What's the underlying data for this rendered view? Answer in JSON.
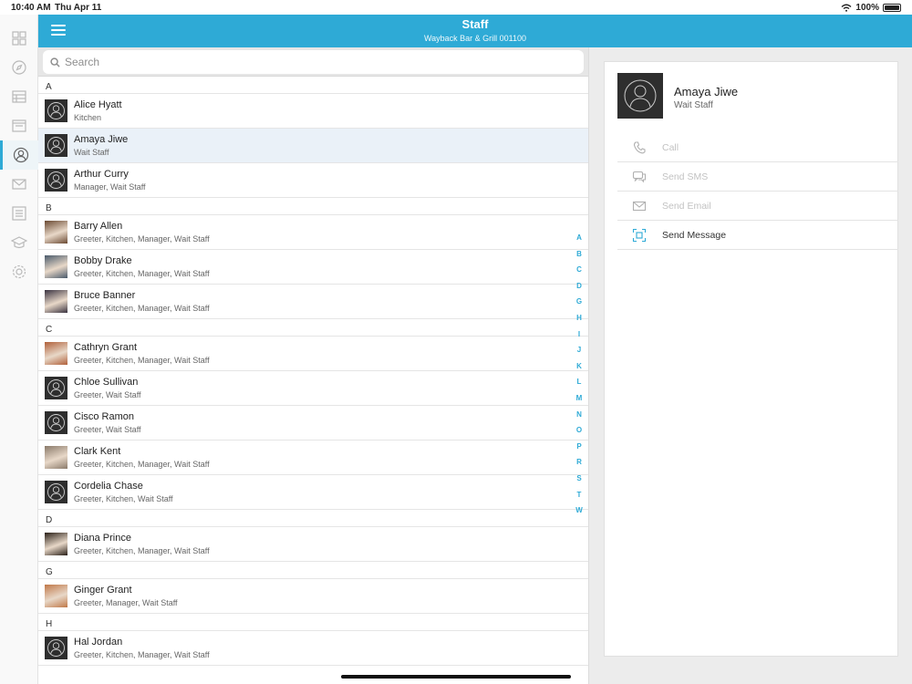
{
  "status": {
    "time": "10:40 AM",
    "date": "Thu Apr 11",
    "battery": "100%"
  },
  "rail": {
    "items": [
      {
        "icon": "dashboard-icon",
        "active": false
      },
      {
        "icon": "compass-icon",
        "active": false
      },
      {
        "icon": "table-icon",
        "active": false
      },
      {
        "icon": "calendar-icon",
        "active": false
      },
      {
        "icon": "staff-icon",
        "active": true
      },
      {
        "icon": "mail-icon",
        "active": false
      },
      {
        "icon": "checklist-icon",
        "active": false
      },
      {
        "icon": "training-icon",
        "active": false
      },
      {
        "icon": "settings-icon",
        "active": false
      }
    ]
  },
  "header": {
    "title": "Staff",
    "subtitle": "Wayback Bar & Grill 001100"
  },
  "search": {
    "placeholder": "Search"
  },
  "sections": [
    {
      "letter": "A",
      "people": [
        {
          "name": "Alice Hyatt",
          "roles": "Kitchen",
          "photo": null
        },
        {
          "name": "Amaya Jiwe",
          "roles": "Wait Staff",
          "photo": null,
          "selected": true
        },
        {
          "name": "Arthur Curry",
          "roles": "Manager, Wait Staff",
          "photo": null
        }
      ]
    },
    {
      "letter": "B",
      "people": [
        {
          "name": "Barry Allen",
          "roles": "Greeter, Kitchen, Manager, Wait Staff",
          "photo": "#6b4a33"
        },
        {
          "name": "Bobby Drake",
          "roles": "Greeter, Kitchen, Manager, Wait Staff",
          "photo": "#4a5a6b"
        },
        {
          "name": "Bruce Banner",
          "roles": "Greeter, Kitchen, Manager, Wait Staff",
          "photo": "#3a3340"
        }
      ]
    },
    {
      "letter": "C",
      "people": [
        {
          "name": "Cathryn Grant",
          "roles": "Greeter, Kitchen, Manager, Wait Staff",
          "photo": "#b0603a"
        },
        {
          "name": "Chloe Sullivan",
          "roles": "Greeter, Wait Staff",
          "photo": null
        },
        {
          "name": "Cisco Ramon",
          "roles": "Greeter, Wait Staff",
          "photo": null
        },
        {
          "name": "Clark Kent",
          "roles": "Greeter, Kitchen, Manager, Wait Staff",
          "photo": "#8a7a6a"
        },
        {
          "name": "Cordelia Chase",
          "roles": "Greeter, Kitchen, Wait Staff",
          "photo": null
        }
      ]
    },
    {
      "letter": "D",
      "people": [
        {
          "name": "Diana Prince",
          "roles": "Greeter, Kitchen, Manager, Wait Staff",
          "photo": "#2a2018"
        }
      ]
    },
    {
      "letter": "G",
      "people": [
        {
          "name": "Ginger Grant",
          "roles": "Greeter, Manager, Wait Staff",
          "photo": "#c07848"
        }
      ]
    },
    {
      "letter": "H",
      "people": [
        {
          "name": "Hal Jordan",
          "roles": "Greeter, Kitchen, Manager, Wait Staff",
          "photo": null
        }
      ]
    }
  ],
  "index_letters": [
    "A",
    "B",
    "C",
    "D",
    "G",
    "H",
    "I",
    "J",
    "K",
    "L",
    "M",
    "N",
    "O",
    "P",
    "R",
    "S",
    "T",
    "W"
  ],
  "detail": {
    "name": "Amaya Jiwe",
    "role": "Wait Staff",
    "actions": [
      {
        "label": "Call",
        "icon": "phone-icon",
        "enabled": false
      },
      {
        "label": "Send SMS",
        "icon": "chat-icon",
        "enabled": false
      },
      {
        "label": "Send Email",
        "icon": "mail-icon",
        "enabled": false
      },
      {
        "label": "Send Message",
        "icon": "message-icon",
        "enabled": true
      }
    ]
  },
  "colors": {
    "accent": "#2eaad6",
    "selected_row": "#eaf1f8"
  }
}
